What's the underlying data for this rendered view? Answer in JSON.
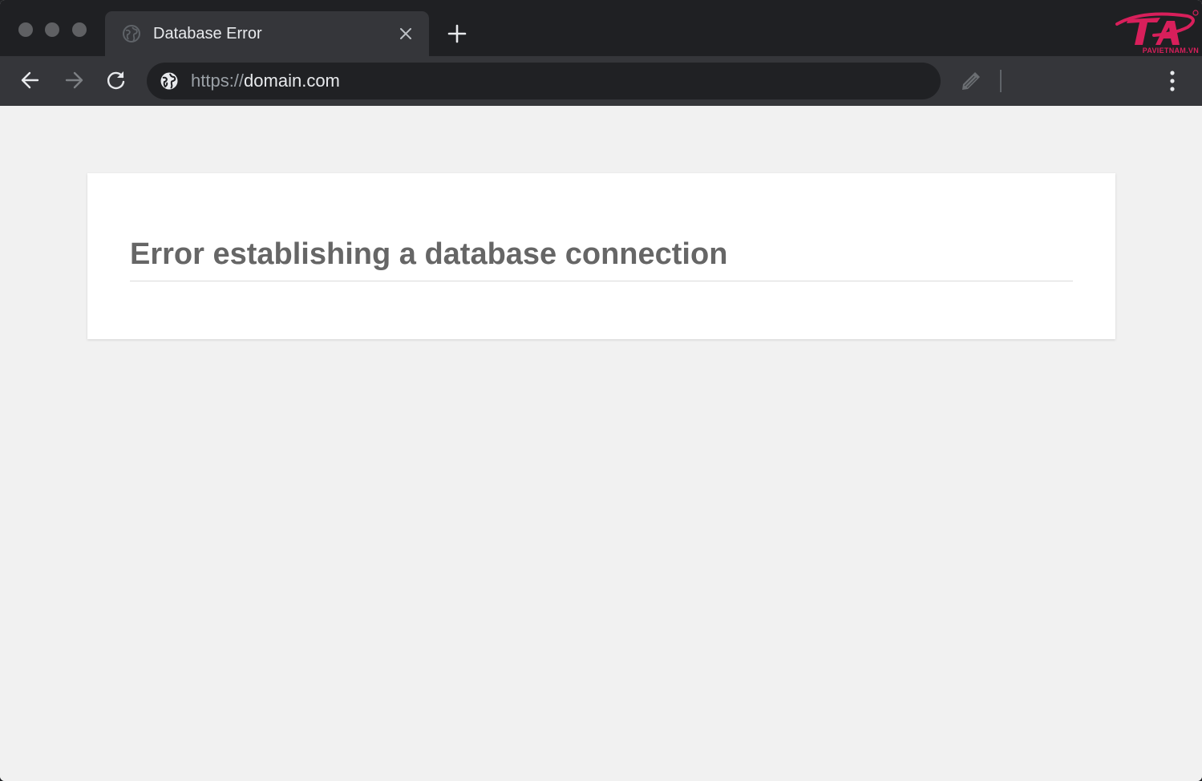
{
  "browser": {
    "tab": {
      "title": "Database Error",
      "favicon": "globe-icon",
      "close_icon": "close-icon"
    },
    "new_tab_icon": "plus-icon",
    "toolbar": {
      "back_icon": "arrow-left-icon",
      "forward_icon": "arrow-right-icon",
      "reload_icon": "reload-icon",
      "site_info_icon": "globe-icon",
      "url_scheme": "https://",
      "url_host": "domain.com",
      "extension_icon": "pencil-icon",
      "menu_icon": "vertical-dots-icon"
    },
    "colors": {
      "tabstrip": "#1f2023",
      "toolbar": "#35363a",
      "omnibox": "#202124",
      "brand": "#d81f5b"
    }
  },
  "watermark": {
    "text": "PAVIETNAM.VN"
  },
  "page": {
    "error_heading": "Error establishing a database connection",
    "colors": {
      "background": "#f1f1f1",
      "card": "#ffffff",
      "heading": "#666666"
    }
  }
}
